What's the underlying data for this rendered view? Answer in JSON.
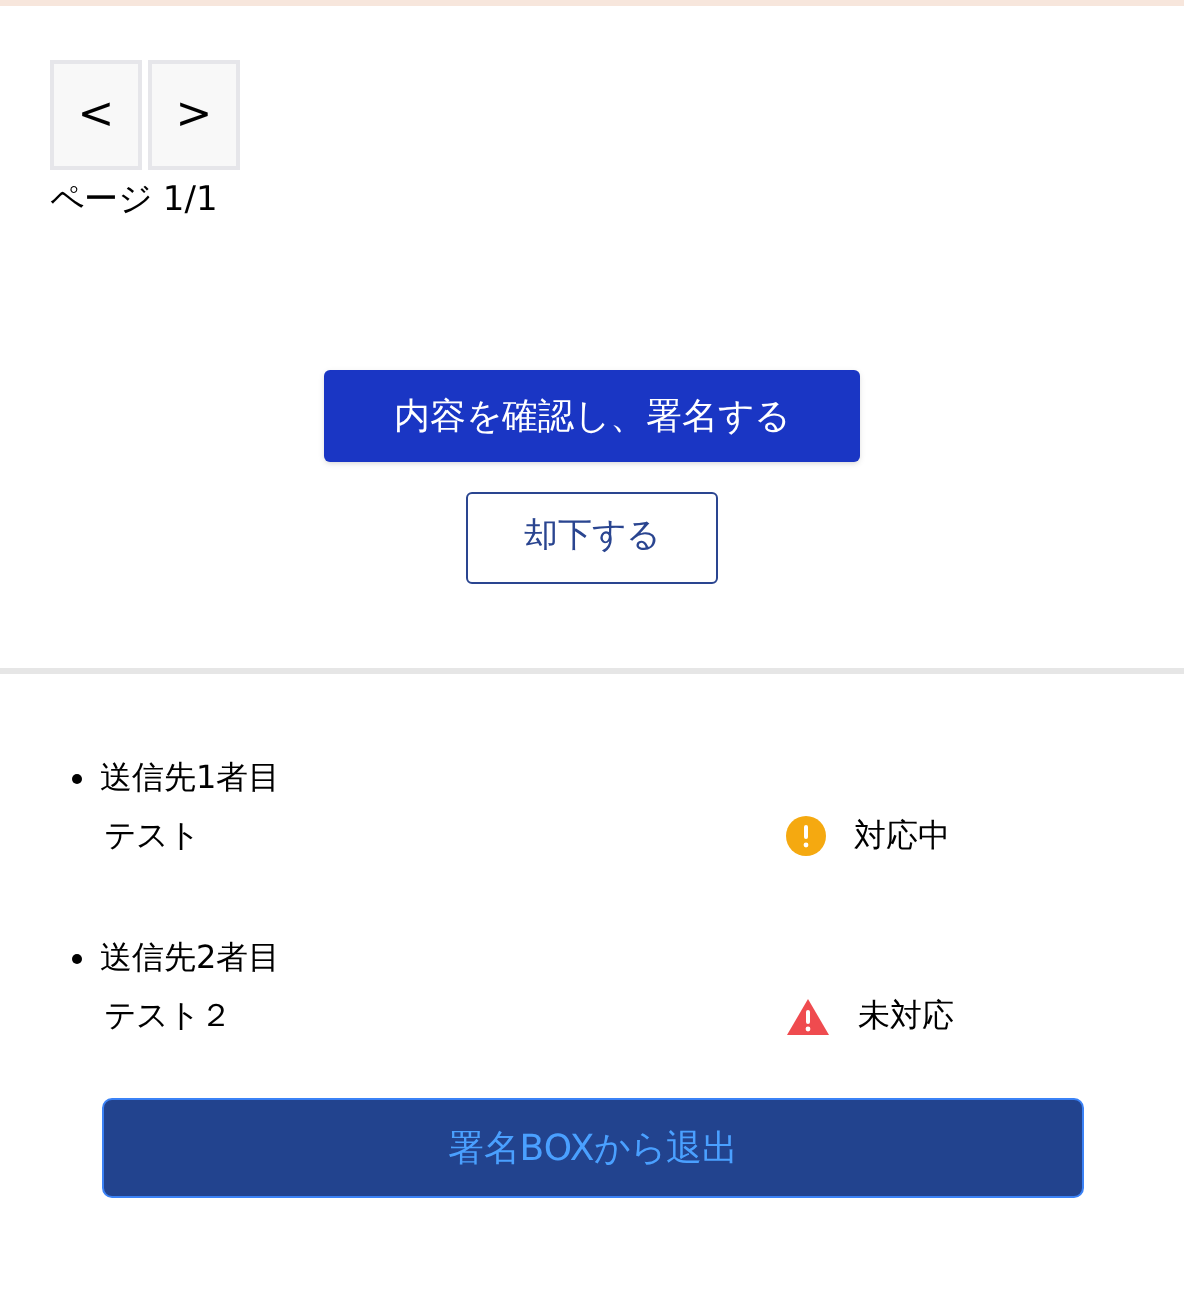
{
  "pager": {
    "prev": "<",
    "next": ">",
    "label": "ページ 1/1"
  },
  "actions": {
    "confirm": "内容を確認し、署名する",
    "reject": "却下する"
  },
  "recipients": [
    {
      "title": "送信先1者目",
      "name": "テスト",
      "status": {
        "kind": "warning",
        "label": "対応中"
      }
    },
    {
      "title": "送信先2者目",
      "name": "テスト２",
      "status": {
        "kind": "alert",
        "label": "未対応"
      }
    }
  ],
  "exit_button": "署名BOXから退出"
}
